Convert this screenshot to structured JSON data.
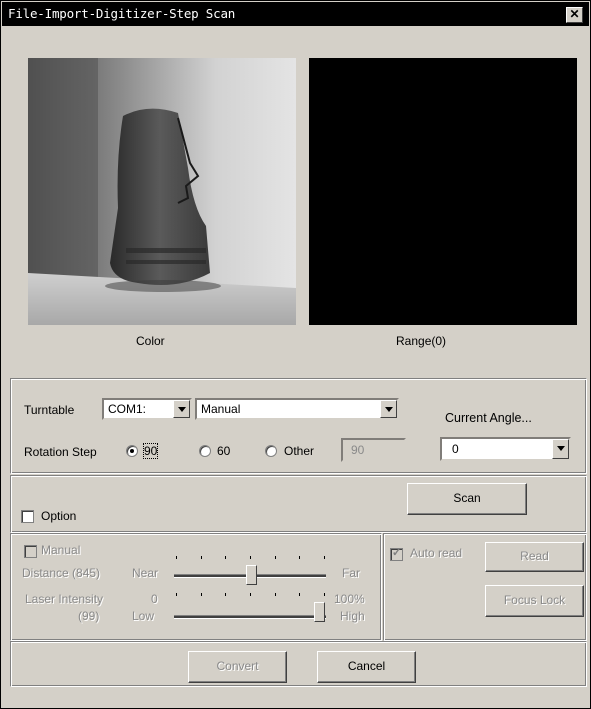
{
  "window": {
    "title": "File-Import-Digitizer-Step Scan",
    "close_glyph": "✕"
  },
  "views": {
    "color_label": "Color",
    "range_label": "Range(0)"
  },
  "turntable": {
    "label": "Turntable",
    "port_value": "COM1:",
    "mode_value": "Manual",
    "current_angle_label": "Current Angle...",
    "current_angle_value": "0",
    "rotation_step_label": "Rotation Step",
    "options": [
      {
        "label": "90",
        "selected": true
      },
      {
        "label": "60",
        "selected": false
      },
      {
        "label": "Other",
        "selected": false
      }
    ],
    "other_value": "90"
  },
  "scan": {
    "option_label": "Option",
    "scan_button": "Scan"
  },
  "manual": {
    "manual_label": "Manual",
    "distance_label": "Distance (845)",
    "near_label": "Near",
    "far_label": "Far",
    "distance_fraction": 0.51,
    "laser_label": "Laser Intensity",
    "laser_value_label": "(99)",
    "laser_min": "0",
    "laser_max": "100%",
    "low_label": "Low",
    "high_label": "High",
    "laser_fraction": 0.99
  },
  "auto": {
    "auto_read_label": "Auto read",
    "read_button": "Read",
    "focus_lock_button": "Focus Lock"
  },
  "footer": {
    "convert_button": "Convert",
    "cancel_button": "Cancel"
  }
}
